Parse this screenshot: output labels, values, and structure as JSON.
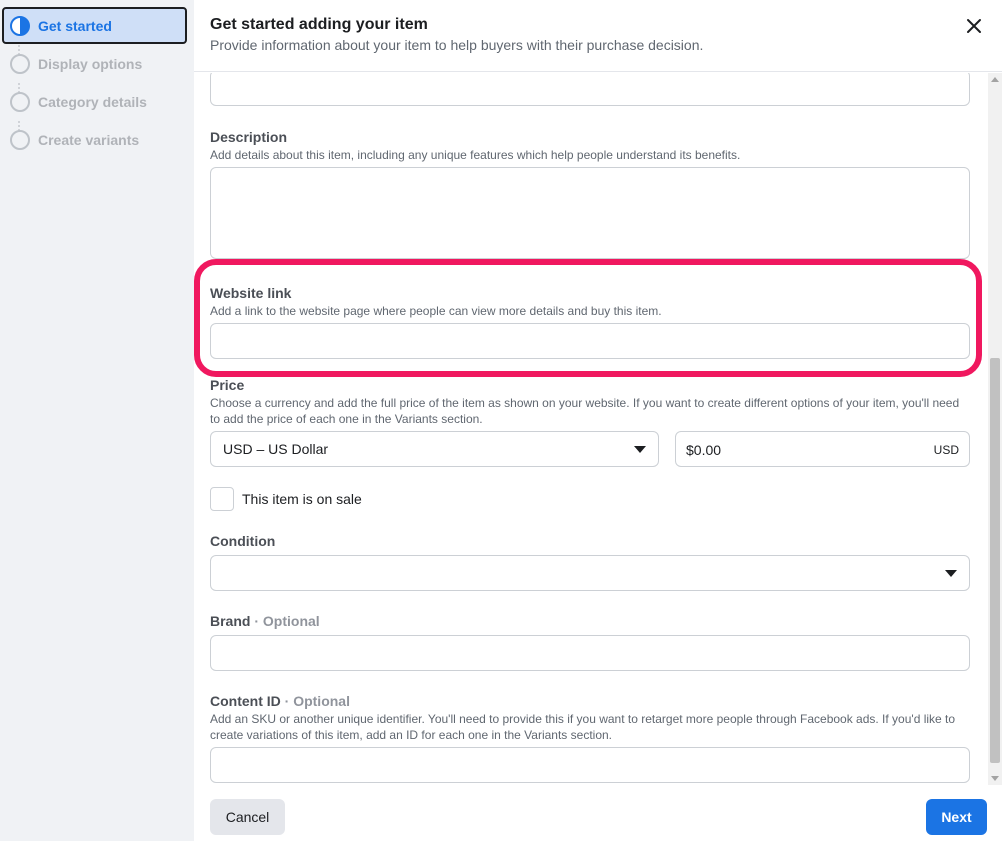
{
  "sidebar": {
    "steps": [
      {
        "label": "Get started",
        "state": "active"
      },
      {
        "label": "Display options",
        "state": "inactive"
      },
      {
        "label": "Category details",
        "state": "inactive"
      },
      {
        "label": "Create variants",
        "state": "inactive"
      }
    ]
  },
  "header": {
    "title": "Get started adding your item",
    "subtitle": "Provide information about your item to help buyers with their purchase decision.",
    "close_icon": "close-icon"
  },
  "form": {
    "description": {
      "label": "Description",
      "help": "Add details about this item, including any unique features which help people understand its benefits.",
      "value": ""
    },
    "website_link": {
      "label": "Website link",
      "help": "Add a link to the website page where people can view more details and buy this item.",
      "value": ""
    },
    "price": {
      "label": "Price",
      "help": "Choose a currency and add the full price of the item as shown on your website. If you want to create different options of your item, you'll need to add the price of each one in the Variants section.",
      "currency": "USD – US Dollar",
      "amount": "$0.00",
      "unit": "USD"
    },
    "on_sale": {
      "label": "This item is on sale",
      "checked": false
    },
    "condition": {
      "label": "Condition",
      "value": ""
    },
    "brand": {
      "label": "Brand",
      "optional": "· Optional",
      "value": ""
    },
    "content_id": {
      "label": "Content ID",
      "optional": "· Optional",
      "help": "Add an SKU or another unique identifier. You'll need to provide this if you want to retarget more people through Facebook ads. If you'd like to create variations of this item, add an ID for each one in the Variants section.",
      "value": ""
    }
  },
  "footer": {
    "cancel_label": "Cancel",
    "next_label": "Next"
  },
  "colors": {
    "accent": "#1b74e4",
    "highlight": "#f0185f",
    "active_step_bg": "#cfdff7"
  }
}
